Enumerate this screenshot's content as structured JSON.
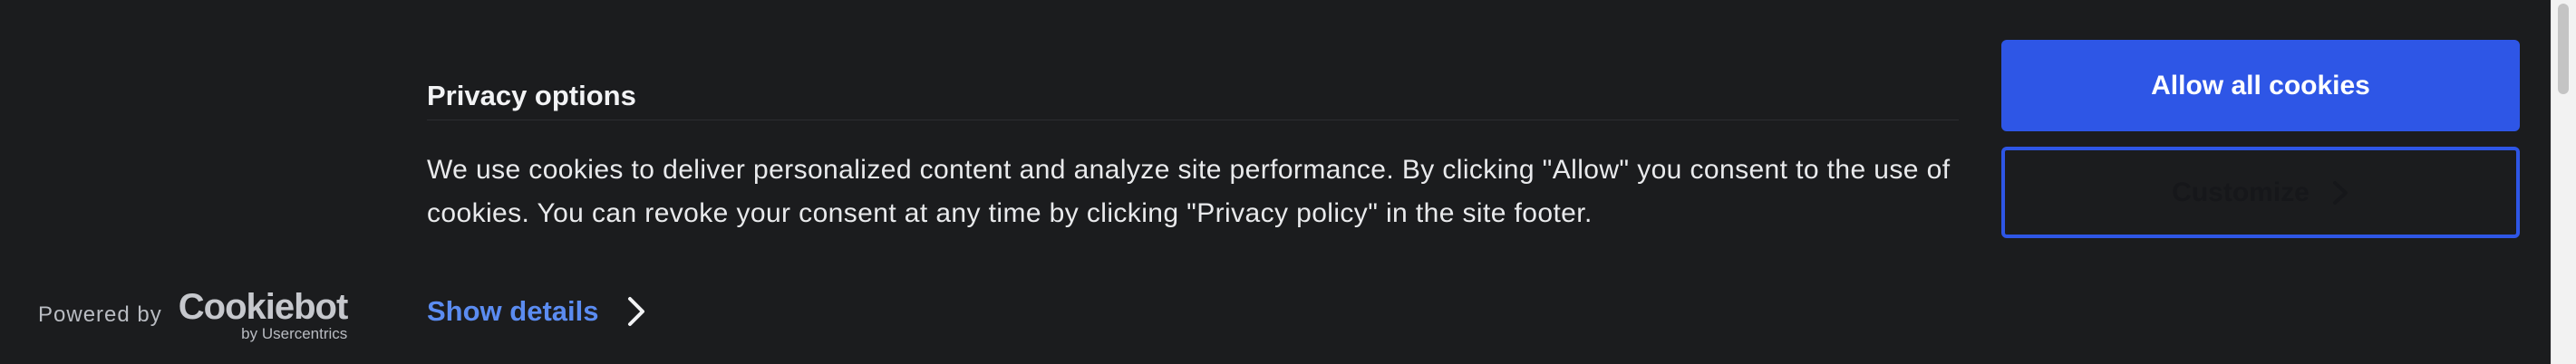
{
  "branding": {
    "powered_by": "Powered by",
    "logo_wordmark": "Cookiebot",
    "logo_sub": "by Usercentrics"
  },
  "dialog": {
    "title": "Privacy options",
    "body": "We use cookies to deliver personalized content and analyze site performance. By clicking \"Allow\" you consent to the use of cookies. You can revoke your consent at any time by clicking \"Privacy policy\" in the site footer.",
    "show_details_label": "Show details"
  },
  "buttons": {
    "allow_all_label": "Allow all cookies",
    "customize_label": "Customize"
  },
  "icons": {
    "show_details_chevron": "chevron-right-icon",
    "customize_chevron": "chevron-right-icon"
  },
  "colors": {
    "background": "#1b1c1e",
    "accent": "#2e56e6",
    "link": "#5b8cf1",
    "text": "#e9eaec"
  }
}
